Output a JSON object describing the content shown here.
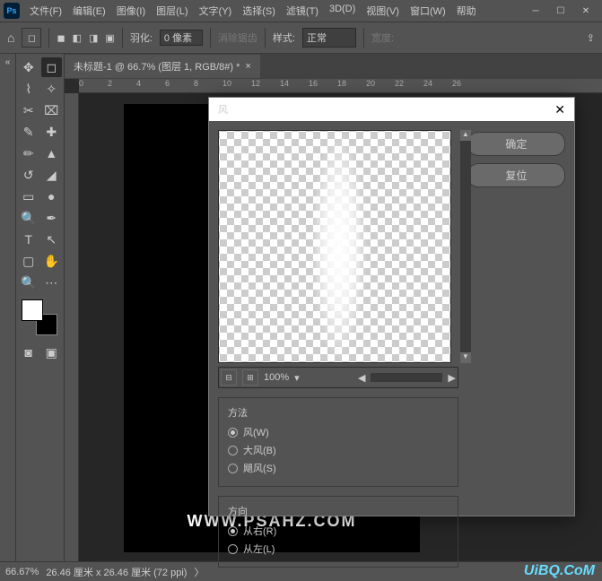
{
  "menu": {
    "file": "文件(F)",
    "edit": "编辑(E)",
    "image": "图像(I)",
    "layer": "图层(L)",
    "type": "文字(Y)",
    "select": "选择(S)",
    "filter": "滤镜(T)",
    "three_d": "3D(D)",
    "view": "视图(V)",
    "window": "窗口(W)",
    "help": "帮助"
  },
  "options": {
    "feather_label": "羽化:",
    "feather_value": "0 像素",
    "antialias": "消除锯齿",
    "style_label": "样式:",
    "style_value": "正常",
    "width_label": "宽度:"
  },
  "tab": {
    "title": "未标题-1 @ 66.7% (图层 1, RGB/8#) *"
  },
  "ruler": {
    "ticks": [
      "0",
      "2",
      "4",
      "6",
      "8",
      "10",
      "12",
      "14",
      "16",
      "18",
      "20",
      "22",
      "24",
      "26"
    ]
  },
  "status": {
    "zoom": "66.67%",
    "info": "26.46 厘米 x 26.46 厘米 (72 ppi)"
  },
  "watermark": "WWW.PSAHZ.COM",
  "uibq": "UiBQ.CoM",
  "dialog": {
    "title": "风",
    "zoom": "100%",
    "ok": "确定",
    "cancel": "复位",
    "method": {
      "label": "方法",
      "wind": "风(W)",
      "big": "大风(B)",
      "hurricane": "飓风(S)"
    },
    "direction": {
      "label": "方向",
      "from_right": "从右(R)",
      "from_left": "从左(L)"
    }
  }
}
